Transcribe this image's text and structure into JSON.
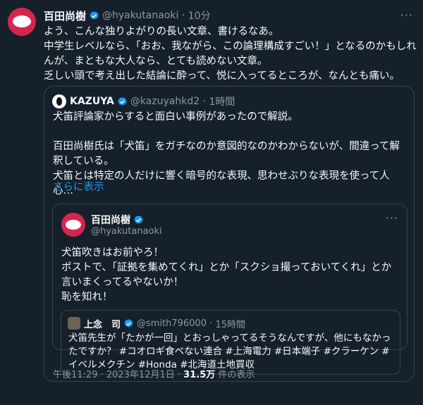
{
  "tweet": {
    "author_name": "百田尚樹",
    "handle": "@hyakutanaoki",
    "time": "10分",
    "more_icon": "more-horizontal-icon",
    "text": "よう、こんな独りよがりの長い文章、書けるなあ。\n中学生レベルなら、「おお、我ながら、この論理構成すごい！」となるのかもしれんが、まともな大人なら、とても読めない文章。\n乏しい頭で考え出した結論に酔って、悦に入ってるところが、なんとも痛い。"
  },
  "quote": {
    "author_name": "KAZUYA",
    "handle": "@kazuyahkd2",
    "time": "1時間",
    "text": "犬笛評論家からすると面白い事例があったので解説。\n\n百田尚樹氏は「犬笛」をガチなのか意図的なのかわからないが、間違って解釈している。\n犬笛とは特定の人だけに響く暗号的な表現、思わせぶりな表現を使って人心…",
    "show_more": "さらに表示"
  },
  "inner": {
    "author_name": "百田尚樹",
    "handle": "@hyakutanaoki",
    "text": "犬笛吹きはお前やろ！\nポストで、「証拠を集めてくれ」とか「スクショ撮っておいてくれ」とか言いまくってるやないか！\n恥を知れ！"
  },
  "inner_quote": {
    "author_name": "上念　司",
    "handle": "@smith796000",
    "time": "15時間",
    "text": "犬笛先生が「たかが一回」とおっしゃってるそうなんですが、他にもなかったですか？ #コオロギ食べない連合 #上海電力 #日本端子 #クラーケン #イベルメクチン #Honda #北海道土地買収"
  },
  "meta": {
    "timestamp": "午後11:29 · 2023年12月1日",
    "sep": " · ",
    "views_count": "31.5万",
    "views_label": " 件の表示"
  },
  "colors": {
    "background": "#15202b",
    "text": "#f7f9f9",
    "muted": "#8b98a5",
    "link": "#1d9bf0",
    "verified": "#1d9bf0",
    "avatar": "#d6254f"
  }
}
